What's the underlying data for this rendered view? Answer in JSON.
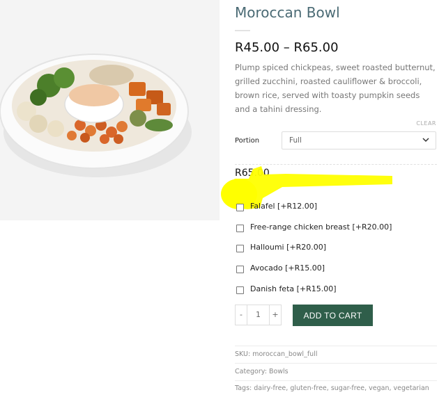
{
  "product": {
    "title": "Moroccan Bowl",
    "price_range": "R45.00 – R65.00",
    "description": "Plump spiced chickpeas, sweet roasted butternut, grilled zucchini, roasted cauliflower & broccoli, brown rice, served with toasty pumpkin seeds and a tahini dressing."
  },
  "variation": {
    "clear_label": "CLEAR",
    "portion_label": "Portion",
    "portion_selected": "Full",
    "price": "R65.00",
    "addon_price": "R"
  },
  "addons": [
    {
      "label": "Falafel [+R12.00]",
      "checked": false
    },
    {
      "label": "Free-range chicken breast [+R20.00]",
      "checked": false
    },
    {
      "label": "Halloumi [+R20.00]",
      "checked": false
    },
    {
      "label": "Avocado [+R15.00]",
      "checked": false
    },
    {
      "label": "Danish feta [+R15.00]",
      "checked": false
    }
  ],
  "cart": {
    "minus": "-",
    "quantity": "1",
    "plus": "+",
    "add_to_cart_label": "ADD TO CART"
  },
  "meta": {
    "sku_label": "SKU:",
    "sku": "moroccan_bowl_full",
    "category_label": "Category:",
    "category": "Bowls",
    "tags_label": "Tags:",
    "tags": [
      "dairy-free",
      "gluten-free",
      "sugar-free",
      "vegan",
      "vegetarian"
    ]
  },
  "colors": {
    "title": "#4a6a74",
    "button": "#2f5e4a",
    "highlight": "#ffff00"
  }
}
